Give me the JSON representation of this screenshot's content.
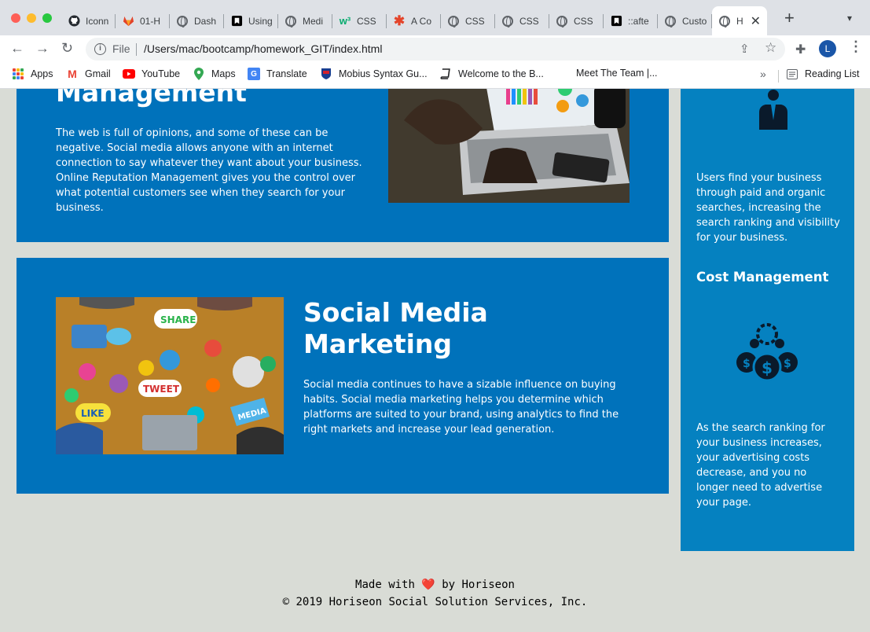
{
  "browser": {
    "tabs": [
      {
        "title": "Iconn",
        "icon": "github-icon"
      },
      {
        "title": "01-H",
        "icon": "gitlab-icon"
      },
      {
        "title": "Dash",
        "icon": "globe-icon"
      },
      {
        "title": "Using",
        "icon": "bookmark-icon"
      },
      {
        "title": "Medi",
        "icon": "globe-icon"
      },
      {
        "title": "CSS",
        "icon": "w3schools-icon"
      },
      {
        "title": "A Co",
        "icon": "asterisk-icon"
      },
      {
        "title": "CSS",
        "icon": "globe-icon"
      },
      {
        "title": "CSS",
        "icon": "globe-icon"
      },
      {
        "title": "CSS",
        "icon": "globe-icon"
      },
      {
        "title": "::afte",
        "icon": "bookmark-icon"
      },
      {
        "title": "Custo",
        "icon": "globe-icon"
      }
    ],
    "active_tab": {
      "title": "H"
    },
    "address": {
      "scheme_label": "File",
      "url": "/Users/mac/bootcamp/homework_GIT/index.html"
    },
    "profile_initial": "L",
    "bookmarks": [
      {
        "label": "Apps",
        "icon": "apps-grid-icon"
      },
      {
        "label": "Gmail",
        "icon": "gmail-icon"
      },
      {
        "label": "YouTube",
        "icon": "youtube-icon"
      },
      {
        "label": "Maps",
        "icon": "maps-icon"
      },
      {
        "label": "Translate",
        "icon": "translate-icon"
      },
      {
        "label": "Mobius Syntax Gu...",
        "icon": "mobius-icon"
      },
      {
        "label": "Welcome to the B...",
        "icon": "book-icon"
      },
      {
        "label": "Meet The Team |...",
        "icon": ""
      }
    ],
    "reading_list": "Reading List"
  },
  "page": {
    "card1": {
      "title": "Management",
      "text": "The web is full of opinions, and some of these can be negative. Social media allows anyone with an internet connection to say whatever they want about your business. Online Reputation Management gives you the control over what potential customers see when they search for your business."
    },
    "card2": {
      "title": "Social Media Marketing",
      "text": "Social media continues to have a sizable influence on buying habits. Social media marketing helps you determine which platforms are suited to your brand, using analytics to find the right markets and increase your lead generation."
    },
    "aside": {
      "text1": "Users find your business through paid and organic searches, increasing the search ranking and visibility for your business.",
      "heading2": "Cost Management",
      "text2": "As the search ranking for your business increases, your advertising costs decrease, and you no longer need to advertise your page."
    },
    "footer": {
      "made_with": "Made with",
      "heart": "❤️",
      "by": "by Horiseon",
      "copyright": "© 2019 Horiseon Social Solution Services, Inc."
    }
  },
  "colors": {
    "card_bg": "#0072bb",
    "aside_bg": "#0581c0",
    "page_bg": "#d9dcd6"
  }
}
